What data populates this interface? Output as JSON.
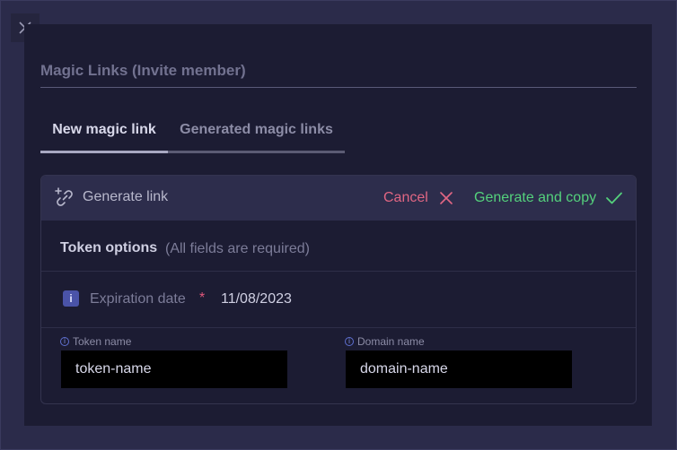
{
  "modal": {
    "title": "Magic Links (Invite member)",
    "close_icon": "close-icon"
  },
  "tabs": [
    {
      "label": "New magic link",
      "active": true
    },
    {
      "label": "Generated magic links",
      "active": false
    }
  ],
  "panel": {
    "header": {
      "icon": "link-add-icon",
      "label": "Generate link",
      "cancel_label": "Cancel",
      "generate_label": "Generate and copy"
    },
    "token_options": {
      "title": "Token options",
      "subtitle": "(All fields are required)"
    },
    "expiration": {
      "info_glyph": "i",
      "label": "Expiration date",
      "required_mark": "*",
      "value": "11/08/2023"
    },
    "fields": [
      {
        "label": "Token name",
        "value": "token-name"
      },
      {
        "label": "Domain name",
        "value": "domain-name"
      }
    ]
  },
  "colors": {
    "cancel": "#e06683",
    "confirm": "#54d17c",
    "accent": "#4a53a8"
  }
}
